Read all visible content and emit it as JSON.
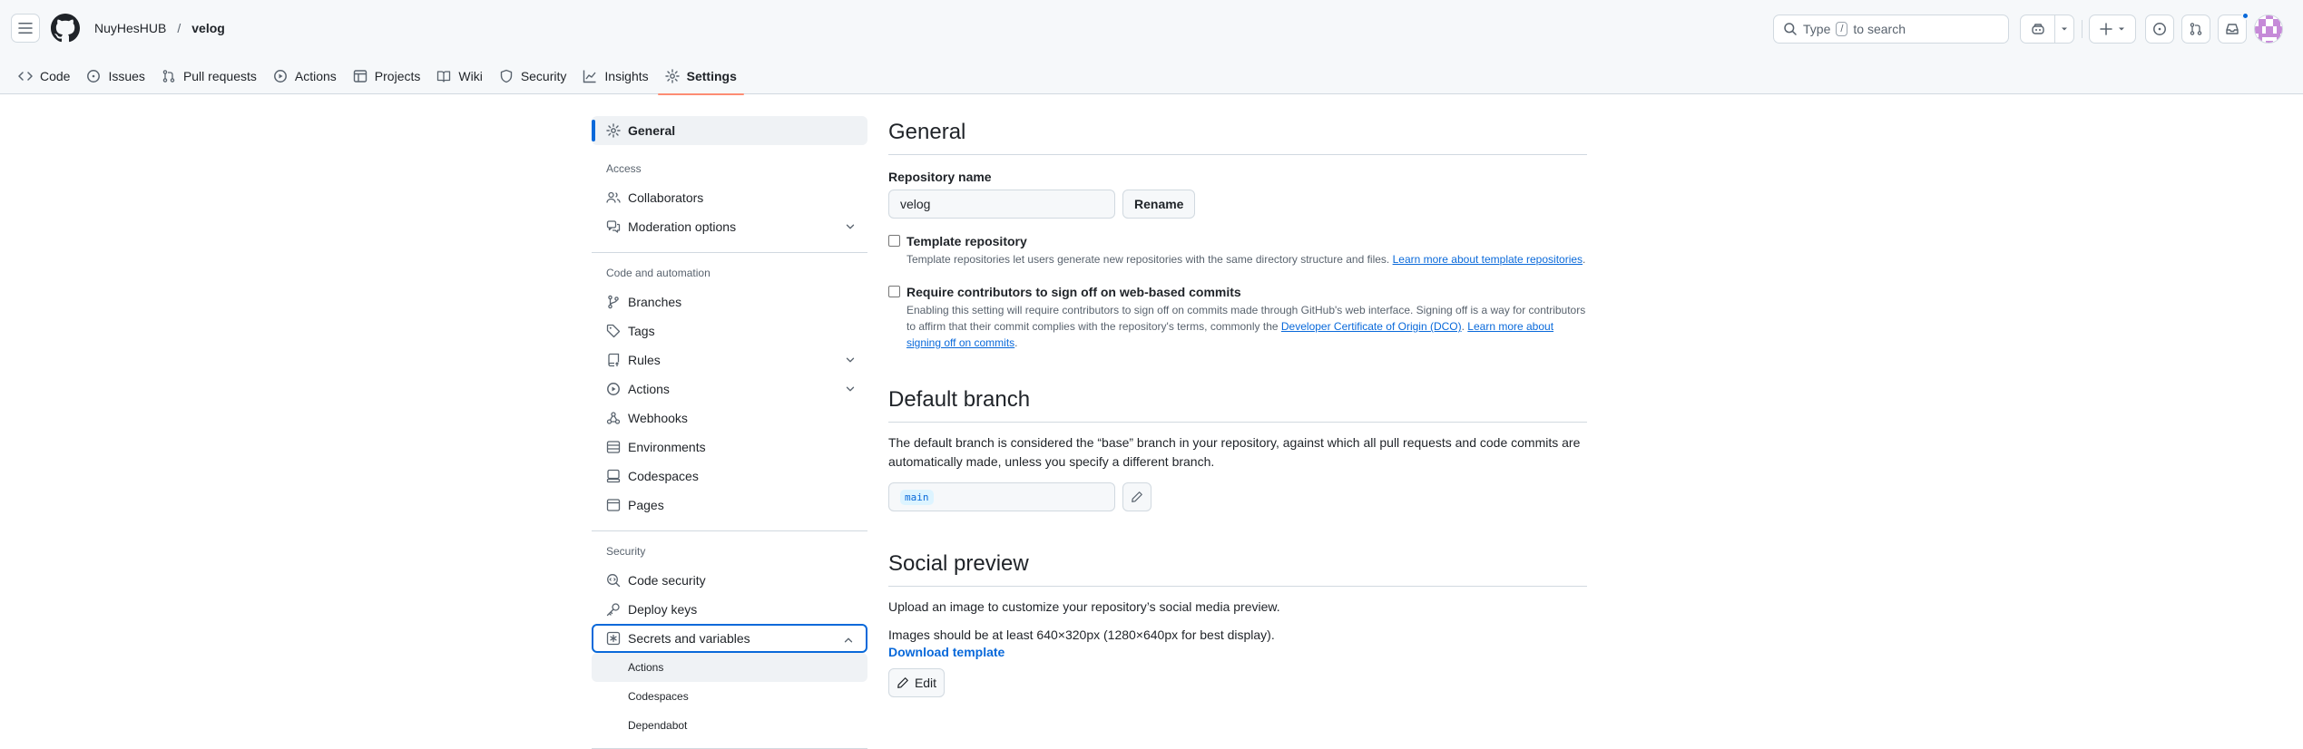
{
  "header": {
    "owner": "NuyHesHUB",
    "separator": "/",
    "repo": "velog",
    "search_prefix": "Type",
    "search_key": "/",
    "search_suffix": "to search"
  },
  "tabs": [
    {
      "label": "Code",
      "icon": "code-icon"
    },
    {
      "label": "Issues",
      "icon": "issue-opened-icon"
    },
    {
      "label": "Pull requests",
      "icon": "git-pull-request-icon"
    },
    {
      "label": "Actions",
      "icon": "play-icon"
    },
    {
      "label": "Projects",
      "icon": "table-icon"
    },
    {
      "label": "Wiki",
      "icon": "book-icon"
    },
    {
      "label": "Security",
      "icon": "shield-icon"
    },
    {
      "label": "Insights",
      "icon": "graph-icon"
    },
    {
      "label": "Settings",
      "icon": "gear-icon",
      "selected": true
    }
  ],
  "sidebar": {
    "general": "General",
    "access_heading": "Access",
    "collaborators": "Collaborators",
    "moderation": "Moderation options",
    "code_heading": "Code and automation",
    "branches": "Branches",
    "tags": "Tags",
    "rules": "Rules",
    "actions": "Actions",
    "webhooks": "Webhooks",
    "environments": "Environments",
    "codespaces": "Codespaces",
    "pages": "Pages",
    "security_heading": "Security",
    "code_security": "Code security",
    "deploy_keys": "Deploy keys",
    "secrets": "Secrets and variables",
    "secrets_sub": [
      "Actions",
      "Codespaces",
      "Dependabot"
    ]
  },
  "main": {
    "general_title": "General",
    "repo_name_label": "Repository name",
    "repo_name_value": "velog",
    "rename_button": "Rename",
    "template_title": "Template repository",
    "template_desc": "Template repositories let users generate new repositories with the same directory structure and files.",
    "template_link": "Learn more about template repositories",
    "signoff_title": "Require contributors to sign off on web-based commits",
    "signoff_desc_1": "Enabling this setting will require contributors to sign off on commits made through GitHub's web interface. Signing off is a way for contributors to affirm that their commit complies with the repository's terms, commonly the",
    "signoff_link_1": "Developer Certificate of Origin (DCO)",
    "signoff_link_2": "Learn more about signing off on commits",
    "default_branch_title": "Default branch",
    "default_branch_desc": "The default branch is considered the “base” branch in your repository, against which all pull requests and code commits are automatically made, unless you specify a different branch.",
    "default_branch_value": "main",
    "social_title": "Social preview",
    "social_desc": "Upload an image to customize your repository’s social media preview.",
    "social_size": "Images should be at least 640×320px (1280×640px for best display).",
    "download_template": "Download template",
    "edit_button": "Edit"
  },
  "colors": {
    "accent": "#0969da",
    "tab_underline": "#fd8c73",
    "border": "#d1d9e0",
    "muted": "#59636e"
  }
}
